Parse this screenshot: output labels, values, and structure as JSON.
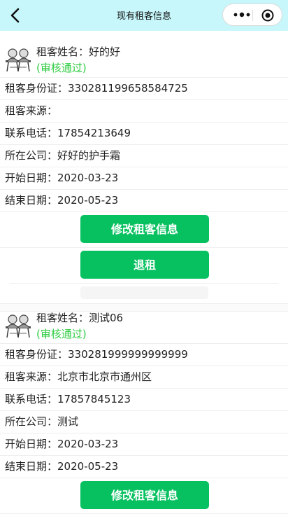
{
  "navbar": {
    "title": "现有租客信息"
  },
  "tenants": [
    {
      "name_label": "租客姓名：",
      "name": "好的好",
      "status": "(审核通过)",
      "rows": [
        {
          "label": "租客身份证：",
          "value": "330281199658584725"
        },
        {
          "label": "租客来源：",
          "value": ""
        },
        {
          "label": "联系电话：",
          "value": "17854213649"
        },
        {
          "label": "所在公司：",
          "value": "好好的护手霜"
        },
        {
          "label": "开始日期：",
          "value": "2020-03-23"
        },
        {
          "label": "结束日期：",
          "value": "2020-05-23"
        }
      ],
      "edit_label": "修改租客信息",
      "checkout_label": "退租"
    },
    {
      "name_label": "租客姓名：",
      "name": "测试06",
      "status": "(审核通过)",
      "rows": [
        {
          "label": "租客身份证：",
          "value": "330281999999999999"
        },
        {
          "label": "租客来源：",
          "value": "北京市北京市通州区"
        },
        {
          "label": "联系电话：",
          "value": "17857845123"
        },
        {
          "label": "所在公司：",
          "value": "测试"
        },
        {
          "label": "开始日期：",
          "value": "2020-03-23"
        },
        {
          "label": "结束日期：",
          "value": "2020-05-23"
        }
      ],
      "edit_label": "修改租客信息"
    }
  ],
  "colors": {
    "navbar": "#c7f7fb",
    "status": "#2ecc40",
    "button": "#07c160"
  },
  "icons": {
    "back": "chevron-left-icon",
    "more": "more-dots-icon",
    "close": "target-circle-icon",
    "avatar": "tenant-avatar-icon"
  }
}
